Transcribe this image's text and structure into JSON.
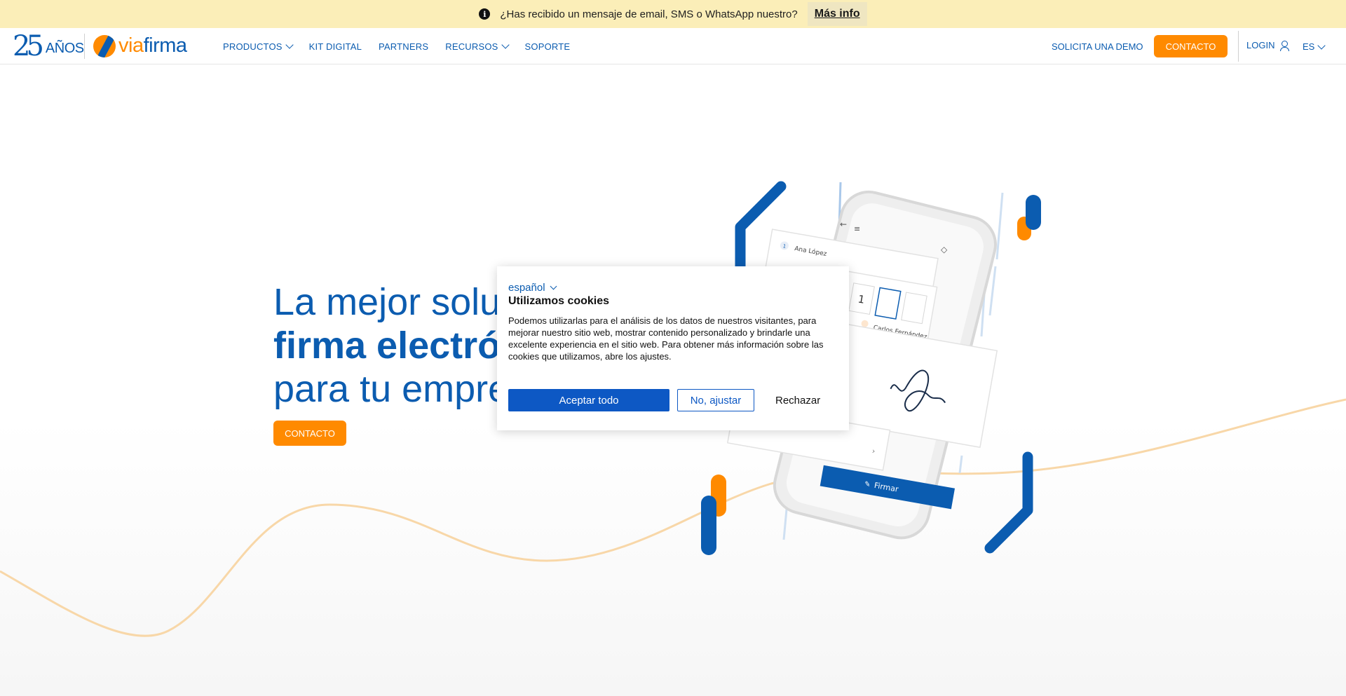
{
  "announcement": {
    "text": "¿Has recibido un mensaje de email, SMS o WhatsApp nuestro?",
    "link": "Más info"
  },
  "brand": {
    "anniversary_number": "25",
    "anniversary_word": "AÑOS",
    "name_part1": "via",
    "name_part2": "firma",
    "colors": {
      "blue": "#0b5cb0",
      "orange": "#ff8a00"
    }
  },
  "nav": {
    "items": [
      {
        "label": "PRODUCTOS",
        "has_dropdown": true
      },
      {
        "label": "KIT DIGITAL",
        "has_dropdown": false
      },
      {
        "label": "PARTNERS",
        "has_dropdown": false
      },
      {
        "label": "RECURSOS",
        "has_dropdown": true
      },
      {
        "label": "SOPORTE",
        "has_dropdown": false
      }
    ],
    "demo": "SOLICITA UNA DEMO",
    "contact": "CONTACTO",
    "login": "LOGIN",
    "language": "ES"
  },
  "hero": {
    "line1": "La mejor solu",
    "line2": "firma electró",
    "line3": "para tu empre",
    "cta": "CONTACTO",
    "illustration": {
      "name1": "Ana López",
      "name2": "Carlos Fernández",
      "code_digit": "1",
      "sign_button": "Firmar"
    }
  },
  "cookie_dialog": {
    "language": "español",
    "title": "Utilizamos cookies",
    "text": "Podemos utilizarlas para el análisis de los datos de nuestros visitantes, para mejorar nuestro sitio web, mostrar contenido personalizado y brindarle una excelente experiencia en el sitio web. Para obtener más información sobre las cookies que utilizamos, abre los ajustes.",
    "accept": "Aceptar todo",
    "adjust": "No, ajustar",
    "reject": "Rechazar"
  }
}
